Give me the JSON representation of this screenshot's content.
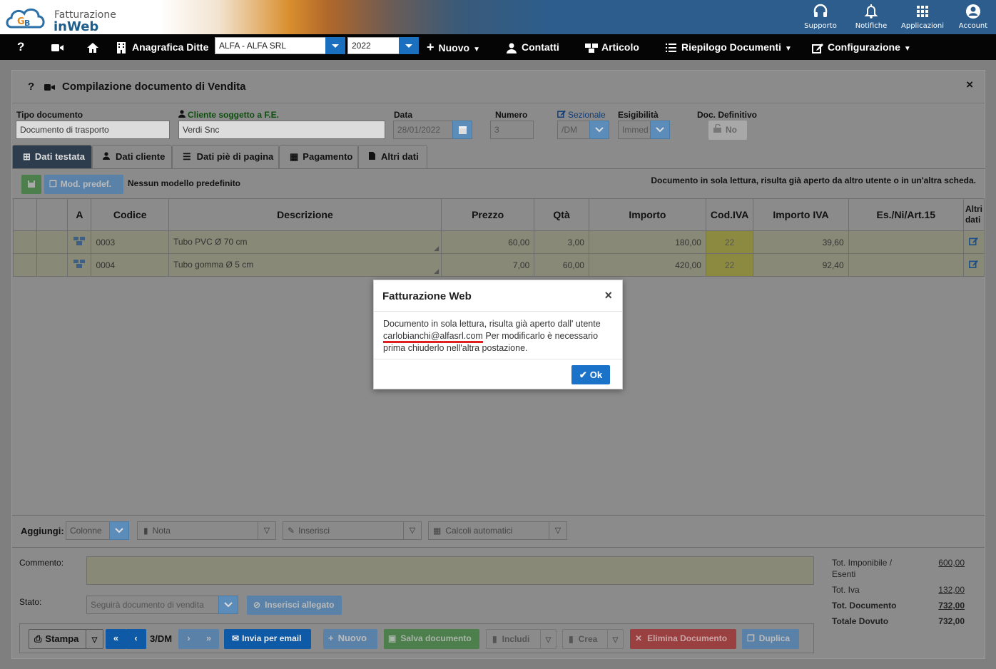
{
  "header": {
    "logo_line1": "Fatturazione",
    "logo_line2": "inWeb",
    "icons": [
      {
        "label": "Supporto",
        "icon": "headset-icon"
      },
      {
        "label": "Notifiche",
        "icon": "bell-icon"
      },
      {
        "label": "Applicazioni",
        "icon": "apps-grid-icon"
      },
      {
        "label": "Account",
        "icon": "user-circle-icon"
      }
    ]
  },
  "nav": {
    "help": "?",
    "anagrafica": "Anagrafica Ditte",
    "company_value": "ALFA - ALFA SRL",
    "year_value": "2022",
    "nuovo": "Nuovo",
    "contatti": "Contatti",
    "articolo": "Articolo",
    "riepilogo": "Riepilogo Documenti",
    "configurazione": "Configurazione"
  },
  "window": {
    "title": "Compilazione documento di Vendita",
    "close": "×",
    "help": "?"
  },
  "form": {
    "tipo_label": "Tipo documento",
    "tipo_value": "Documento di trasporto",
    "cliente_label": "Cliente soggetto a F.E.",
    "cliente_value": "Verdi Snc",
    "data_label": "Data",
    "data_value": "28/01/2022",
    "numero_label": "Numero",
    "numero_value": "3",
    "sezionale_label": "Sezionale",
    "sezionale_value": "/DM",
    "esigibilita_label": "Esigibilità",
    "esigibilita_value": "Immed",
    "docdef_label": "Doc. Definitivo",
    "docdef_value": "No"
  },
  "tabs": [
    "Dati testata",
    "Dati cliente",
    "Dati piè di pagina",
    "Pagamento",
    "Altri dati"
  ],
  "toolbar": {
    "mod_predef": "Mod. predef.",
    "no_model": "Nessun modello predefinito",
    "readonly_msg": "Documento in sola lettura, risulta già aperto da altro utente o in un'altra scheda."
  },
  "grid": {
    "headers": [
      "",
      "",
      "A",
      "Codice",
      "Descrizione",
      "Prezzo",
      "Qtà",
      "Importo",
      "Cod.IVA",
      "Importo IVA",
      "Es./Ni/Art.15",
      "Altri dati"
    ],
    "rows": [
      {
        "codice": "0003",
        "descrizione": "Tubo PVC Ø 70 cm",
        "prezzo": "60,00",
        "qta": "3,00",
        "importo": "180,00",
        "iva": "22",
        "importo_iva": "39,60"
      },
      {
        "codice": "0004",
        "descrizione": "Tubo gomma Ø 5 cm",
        "prezzo": "7,00",
        "qta": "60,00",
        "importo": "420,00",
        "iva": "22",
        "importo_iva": "92,40"
      }
    ]
  },
  "aggiungi": {
    "label": "Aggiungi:",
    "colonne": "Colonne",
    "nota": "Nota",
    "inserisci": "Inserisci",
    "calcoli": "Calcoli automatici"
  },
  "footer": {
    "commento_label": "Commento:",
    "stato_label": "Stato:",
    "stato_value": "Seguirà documento di vendita",
    "allegato": "Inserisci allegato",
    "stampa": "Stampa",
    "page": "3/DM",
    "email": "Invia per email",
    "nuovo": "Nuovo",
    "salva": "Salva documento",
    "includi": "Includi",
    "crea": "Crea",
    "elimina": "Elimina Documento",
    "duplica": "Duplica"
  },
  "totals": {
    "imponibile_label": "Tot. Imponibile /",
    "esenti_label": "Esenti",
    "imponibile": "600,00",
    "iva_label": "Tot. Iva",
    "iva": "132,00",
    "documento_label": "Tot. Documento",
    "documento": "732,00",
    "dovuto_label": "Totale Dovuto",
    "dovuto": "732,00"
  },
  "modal": {
    "title": "Fatturazione Web",
    "close": "×",
    "text_before": "Documento in sola lettura, risulta già aperto dall' utente",
    "user": "carlobianchi@alfasrl.com",
    "text_after": "Per modificarlo è necessario prima chiuderlo nell'altra postazione.",
    "ok": "Ok"
  },
  "colors": {
    "accent": "#1a73c9",
    "underline": "#e02020",
    "header_blue": "#2d5d8c"
  }
}
